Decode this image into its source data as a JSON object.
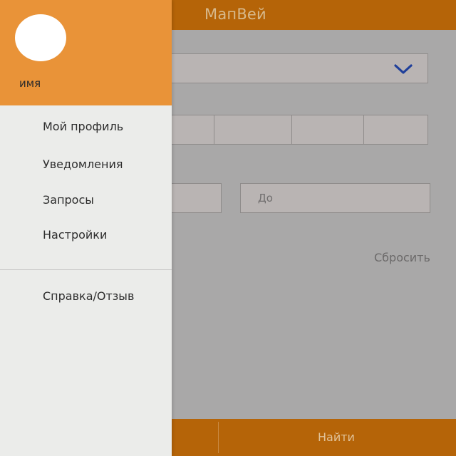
{
  "app": {
    "title": "МапВей"
  },
  "form": {
    "to_placeholder": "До",
    "reset_label": "Сбросить",
    "search_label": "Найти"
  },
  "drawer": {
    "username": "имя",
    "items": [
      {
        "label": "Мой профиль"
      },
      {
        "label": "Уведомления"
      },
      {
        "label": "Запросы"
      },
      {
        "label": "Настройки"
      }
    ],
    "footer_items": [
      {
        "label": "Справка/Отзыв"
      }
    ]
  },
  "colors": {
    "accent": "#b56408",
    "drawer_header": "#e99338",
    "chevron": "#1f3f9a"
  }
}
